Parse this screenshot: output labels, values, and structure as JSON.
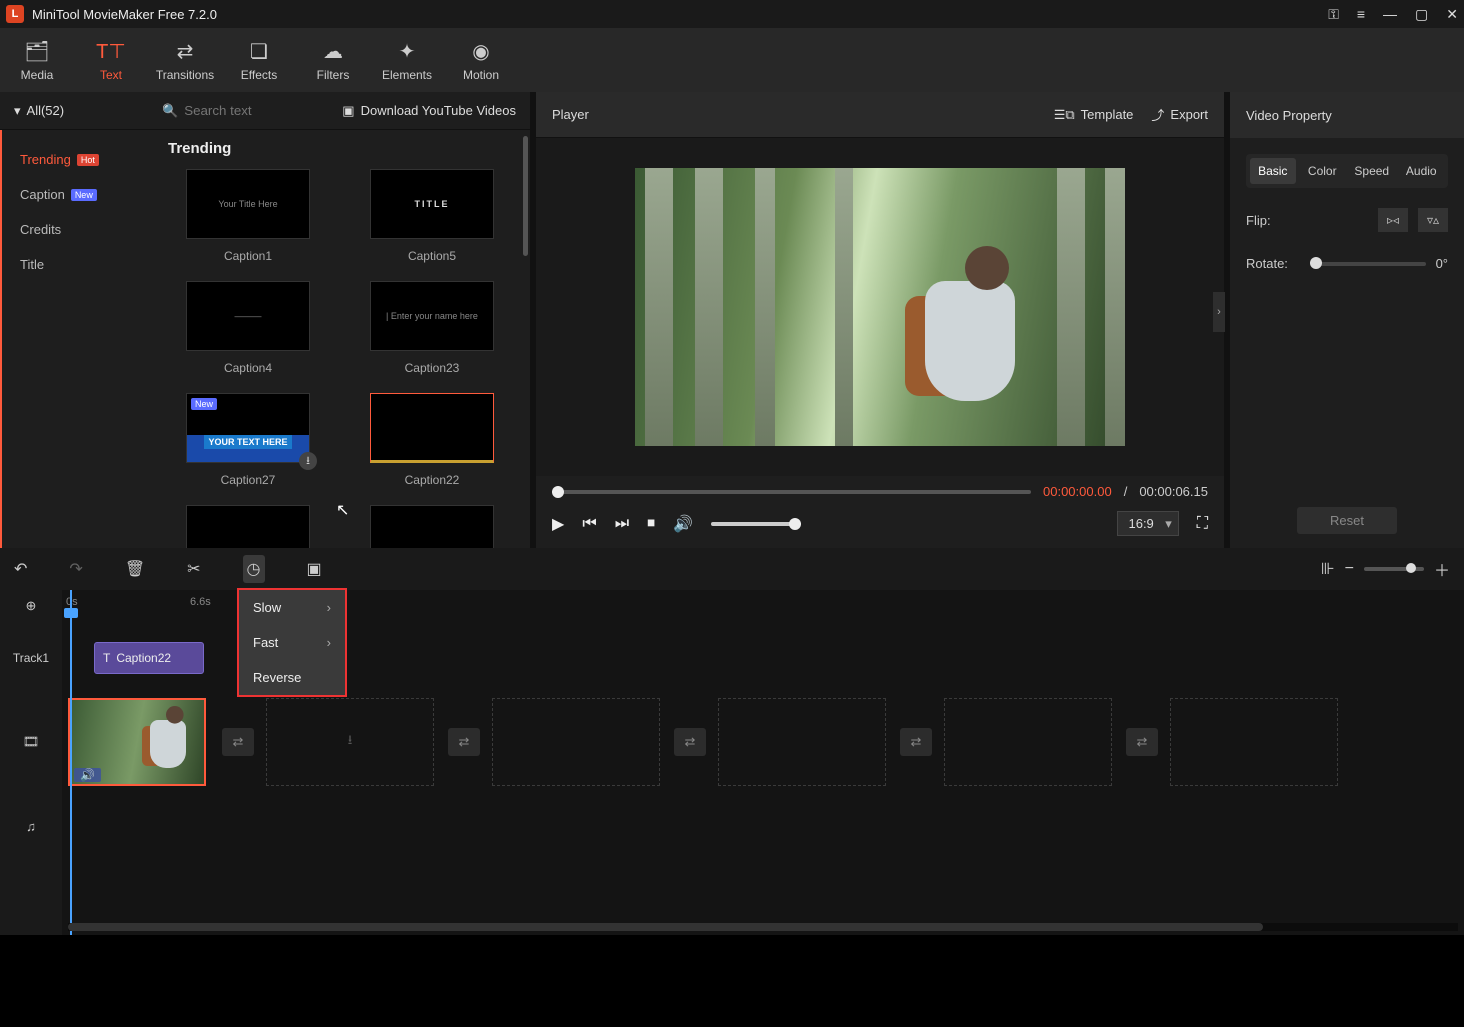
{
  "titlebar": {
    "app_title": "MiniTool MovieMaker Free 7.2.0"
  },
  "tabs": {
    "media": "Media",
    "text": "Text",
    "transitions": "Transitions",
    "effects": "Effects",
    "filters": "Filters",
    "elements": "Elements",
    "motion": "Motion"
  },
  "left_panel": {
    "all_label": "All(52)",
    "search_placeholder": "Search text",
    "youtube_link": "Download YouTube Videos",
    "categories": [
      {
        "label": "Trending",
        "badge": "Hot",
        "active": true
      },
      {
        "label": "Caption",
        "badge": "New"
      },
      {
        "label": "Credits"
      },
      {
        "label": "Title"
      }
    ],
    "grid_title": "Trending",
    "items": [
      {
        "label": "Caption1",
        "inner": "Your Title Here"
      },
      {
        "label": "Caption5",
        "inner": "TITLE"
      },
      {
        "label": "Caption4",
        "inner": "———"
      },
      {
        "label": "Caption23",
        "inner": "| Enter your name here"
      },
      {
        "label": "Caption27",
        "inner": "YOUR TEXT HERE",
        "new": true,
        "download": true
      },
      {
        "label": "Caption22",
        "inner": "",
        "selected": true
      }
    ]
  },
  "player": {
    "header_title": "Player",
    "template_label": "Template",
    "export_label": "Export",
    "time_current": "00:00:00.00",
    "time_separator": "/",
    "time_total": "00:00:06.15",
    "aspect_ratio": "16:9"
  },
  "properties": {
    "header": "Video Property",
    "tabs": {
      "basic": "Basic",
      "color": "Color",
      "speed": "Speed",
      "audio": "Audio"
    },
    "flip_label": "Flip:",
    "rotate_label": "Rotate:",
    "rotate_value": "0°",
    "reset_label": "Reset"
  },
  "timeline": {
    "ruler": {
      "t0": "0s",
      "t1": "6.6s"
    },
    "speed_menu": {
      "slow": "Slow",
      "fast": "Fast",
      "reverse": "Reverse"
    },
    "track1_label": "Track1",
    "text_clip_label": "Caption22"
  }
}
